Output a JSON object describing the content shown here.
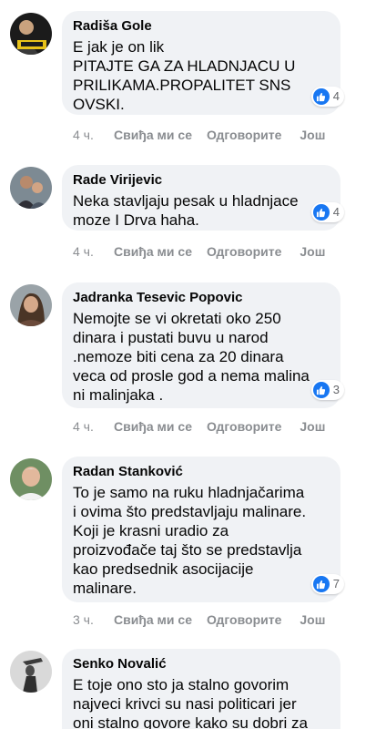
{
  "colors": {
    "bubble": "#f0f2f5",
    "like_blue": "#1877f2",
    "meta_text": "#8a8d91"
  },
  "comments": [
    {
      "author": "Radiša Gole",
      "avatar_icon": "profile-photo-avatar",
      "text": "E jak je on lik\nPITAJTE GA ZA HLADNJACU U PRILIKAMA.PROPALITET SNS OVSKI.",
      "reaction_icon": "like-icon",
      "reaction_count": "4",
      "time": "4 ч.",
      "like_label": "Свиђа ми се",
      "reply_label": "Одговорите",
      "more_label": "Још"
    },
    {
      "author": "Rade Virijevic",
      "avatar_icon": "profile-photo-avatar",
      "text": "Neka stavljaju pesak u hladnjace\nmoze I Drva haha.",
      "reaction_icon": "like-icon",
      "reaction_count": "4",
      "time": "4 ч.",
      "like_label": "Свиђа ми се",
      "reply_label": "Одговорите",
      "more_label": "Још"
    },
    {
      "author": "Jadranka Tesevic Popovic",
      "avatar_icon": "profile-photo-avatar",
      "text": "Nemojte se vi okretati oko 250\ndinara i pustati buvu u narod\n.nemoze biti cena za 20 dinara\nveca od prosle god a nema malina\nni malinjaka .",
      "reaction_icon": "like-icon",
      "reaction_count": "3",
      "time": "4 ч.",
      "like_label": "Свиђа ми се",
      "reply_label": "Одговорите",
      "more_label": "Још"
    },
    {
      "author": "Radan Stanković",
      "avatar_icon": "profile-photo-avatar",
      "text": "To je samo na ruku hladnjačarima\ni ovima što predstavljaju malinare.\nKoji je krasni uradio za\nproizvođače taj što se predstavlja\nkao predsednik asocijacije\nmalinare.",
      "reaction_icon": "like-icon",
      "reaction_count": "7",
      "time": "3 ч.",
      "like_label": "Свиђа ми се",
      "reply_label": "Одговорите",
      "more_label": "Још"
    },
    {
      "author": "Senko Novalić",
      "avatar_icon": "profile-photo-avatar",
      "text": "E toje ono sto ja stalno govorim\nnajveci krivci su nasi politicari jer\noni stalno govore kako su dobri za",
      "reaction_icon": "",
      "reaction_count": "",
      "time": "",
      "like_label": "",
      "reply_label": "",
      "more_label": ""
    }
  ]
}
